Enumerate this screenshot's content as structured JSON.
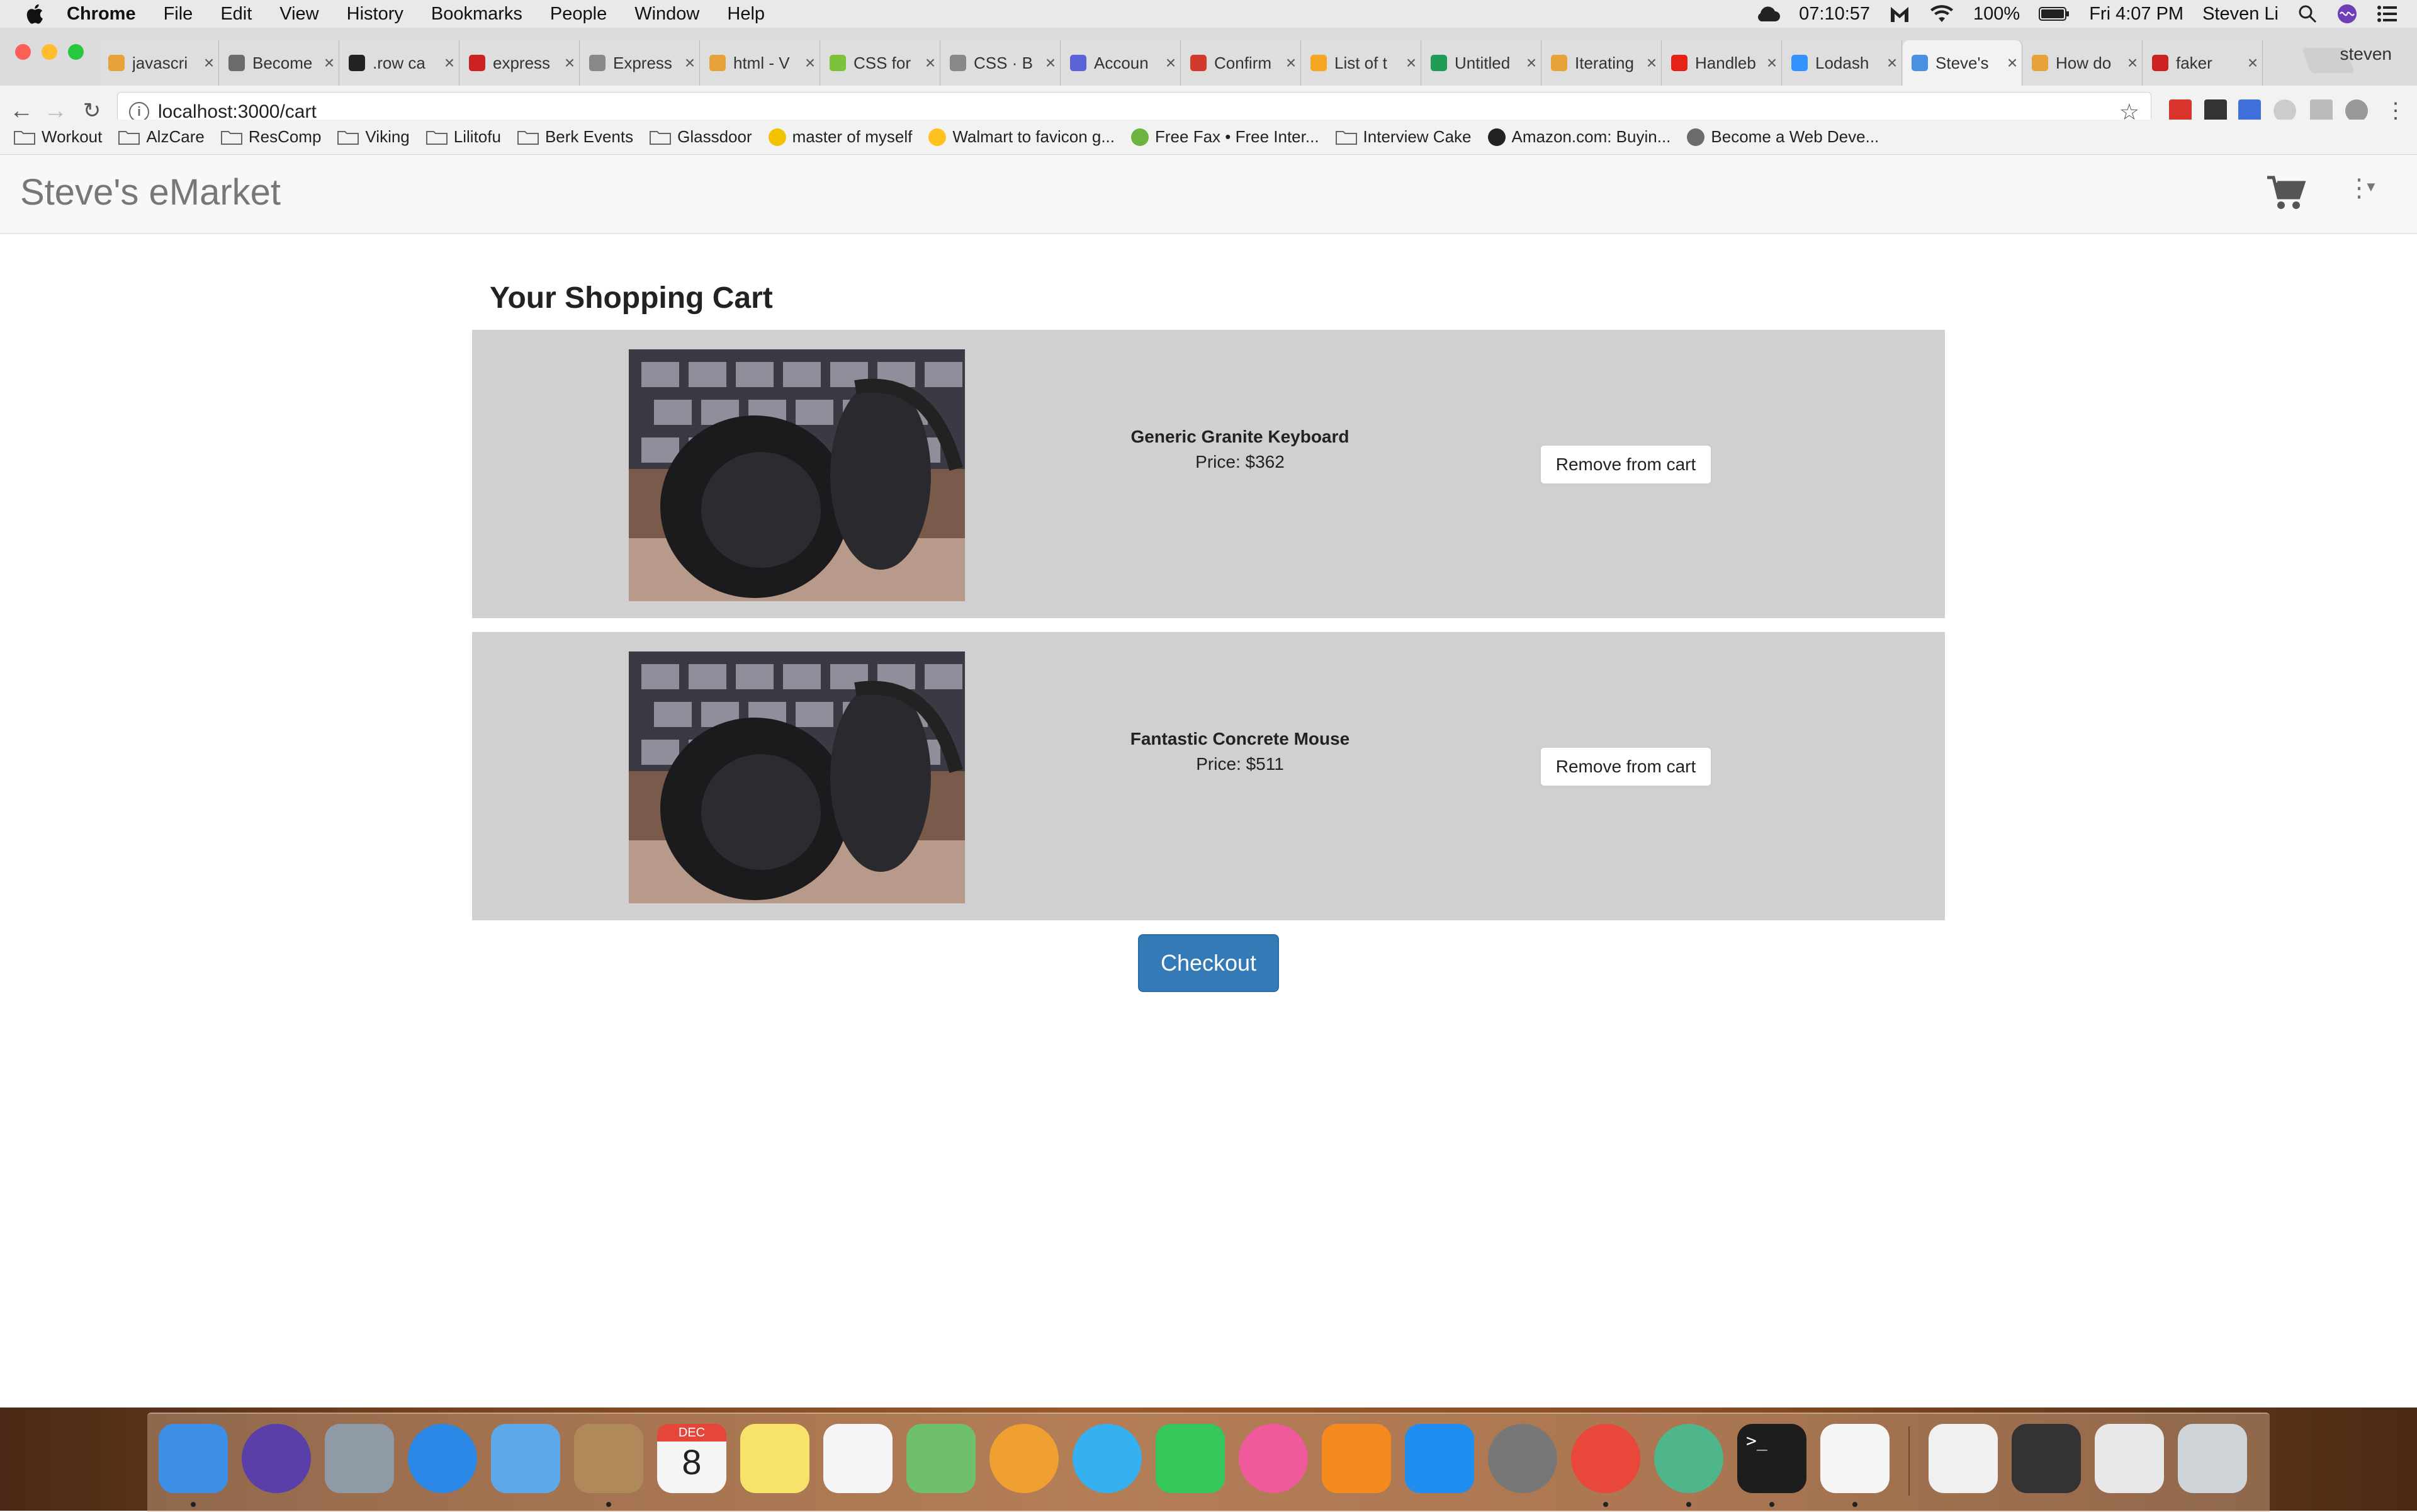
{
  "menubar": {
    "app_name": "Chrome",
    "menus": [
      "File",
      "Edit",
      "View",
      "History",
      "Bookmarks",
      "People",
      "Window",
      "Help"
    ],
    "clock": "07:10:57",
    "battery": "100%",
    "datetime": "Fri 4:07 PM",
    "user": "Steven Li"
  },
  "tabs": [
    {
      "label": "javascri",
      "color": "#e8a23a"
    },
    {
      "label": "Become",
      "color": "#6b6b6b"
    },
    {
      "label": ".row ca",
      "color": "#222222"
    },
    {
      "label": "express",
      "color": "#cc2222"
    },
    {
      "label": "Express",
      "color": "#888888"
    },
    {
      "label": "html - V",
      "color": "#e8a23a"
    },
    {
      "label": "CSS for",
      "color": "#7cc23a"
    },
    {
      "label": "CSS · B",
      "color": "#888888"
    },
    {
      "label": "Accoun",
      "color": "#5a62d6"
    },
    {
      "label": "Confirm",
      "color": "#d23a2e"
    },
    {
      "label": "List of t",
      "color": "#f5a623"
    },
    {
      "label": "Untitled",
      "color": "#1f9d55"
    },
    {
      "label": "Iterating",
      "color": "#e8a23a"
    },
    {
      "label": "Handleb",
      "color": "#e62117"
    },
    {
      "label": "Lodash",
      "color": "#3492ff"
    },
    {
      "label": "Steve's",
      "color": "#4a90e2"
    },
    {
      "label": "How do",
      "color": "#e8a23a"
    },
    {
      "label": "faker",
      "color": "#cc2222"
    }
  ],
  "tab_profile": "steven",
  "address_bar": {
    "url": "localhost:3000/cart"
  },
  "bookmarks": [
    {
      "label": "Workout",
      "type": "folder"
    },
    {
      "label": "AlzCare",
      "type": "folder"
    },
    {
      "label": "ResComp",
      "type": "folder"
    },
    {
      "label": "Viking",
      "type": "folder"
    },
    {
      "label": "Lilitofu",
      "type": "folder"
    },
    {
      "label": "Berk Events",
      "type": "folder"
    },
    {
      "label": "Glassdoor",
      "type": "folder"
    },
    {
      "label": "master of myself",
      "type": "site",
      "color": "#f2c200"
    },
    {
      "label": "Walmart to favicon g...",
      "type": "site",
      "color": "#ffc220"
    },
    {
      "label": "Free Fax • Free Inter...",
      "type": "site",
      "color": "#6cb33f"
    },
    {
      "label": "Interview Cake",
      "type": "folder"
    },
    {
      "label": "Amazon.com: Buyin...",
      "type": "site",
      "color": "#222222"
    },
    {
      "label": "Become a Web Deve...",
      "type": "site",
      "color": "#6b6b6b"
    }
  ],
  "app": {
    "brand": "Steve's eMarket",
    "cart_heading": "Your Shopping Cart",
    "items": [
      {
        "name": "Generic Granite Keyboard",
        "price": "Price: $362",
        "remove_label": "Remove from cart"
      },
      {
        "name": "Fantastic Concrete Mouse",
        "price": "Price: $511",
        "remove_label": "Remove from cart"
      }
    ],
    "checkout_label": "Checkout"
  },
  "dock": [
    {
      "name": "finder-icon",
      "color": "#3d8ee6"
    },
    {
      "name": "siri-icon",
      "color": "#5b3fa8"
    },
    {
      "name": "launchpad-icon",
      "color": "#8f9aa6"
    },
    {
      "name": "safari-icon",
      "color": "#2b88e6"
    },
    {
      "name": "mail-icon",
      "color": "#5fa8e8"
    },
    {
      "name": "contacts-icon",
      "color": "#b0895a"
    },
    {
      "name": "calendar-icon",
      "color": "#f5f5f5"
    },
    {
      "name": "notes-icon",
      "color": "#f7e26a"
    },
    {
      "name": "reminders-icon",
      "color": "#f5f5f5"
    },
    {
      "name": "maps-icon",
      "color": "#6fc06a"
    },
    {
      "name": "photos-icon",
      "color": "#f0a030"
    },
    {
      "name": "messages-icon",
      "color": "#35b0f0"
    },
    {
      "name": "facetime-icon",
      "color": "#35c759"
    },
    {
      "name": "itunes-icon",
      "color": "#ee5a9a"
    },
    {
      "name": "ibooks-icon",
      "color": "#f58a1f"
    },
    {
      "name": "app-store-icon",
      "color": "#1f8ef0"
    },
    {
      "name": "system-preferences-icon",
      "color": "#777777"
    },
    {
      "name": "chrome-icon",
      "color": "#e9473a"
    },
    {
      "name": "atom-icon",
      "color": "#4fb58a"
    },
    {
      "name": "terminal-icon",
      "color": "#1d1d1d"
    },
    {
      "name": "textedit-icon",
      "color": "#f5f5f5"
    },
    {
      "name": "txt-document-icon",
      "color": "#f0f0f0"
    },
    {
      "name": "window-thumbnail-icon",
      "color": "#333333"
    },
    {
      "name": "downloads-stack-icon",
      "color": "#e8e8e8"
    },
    {
      "name": "trash-icon",
      "color": "#cfd4d8"
    }
  ],
  "calendar": {
    "month": "DEC",
    "day": "8"
  },
  "terminal_prompt": ">_",
  "colors": {
    "checkout": "#337ab7",
    "cart_item_bg": "#d0d0d0",
    "navbar_bg": "#f8f8f8"
  }
}
